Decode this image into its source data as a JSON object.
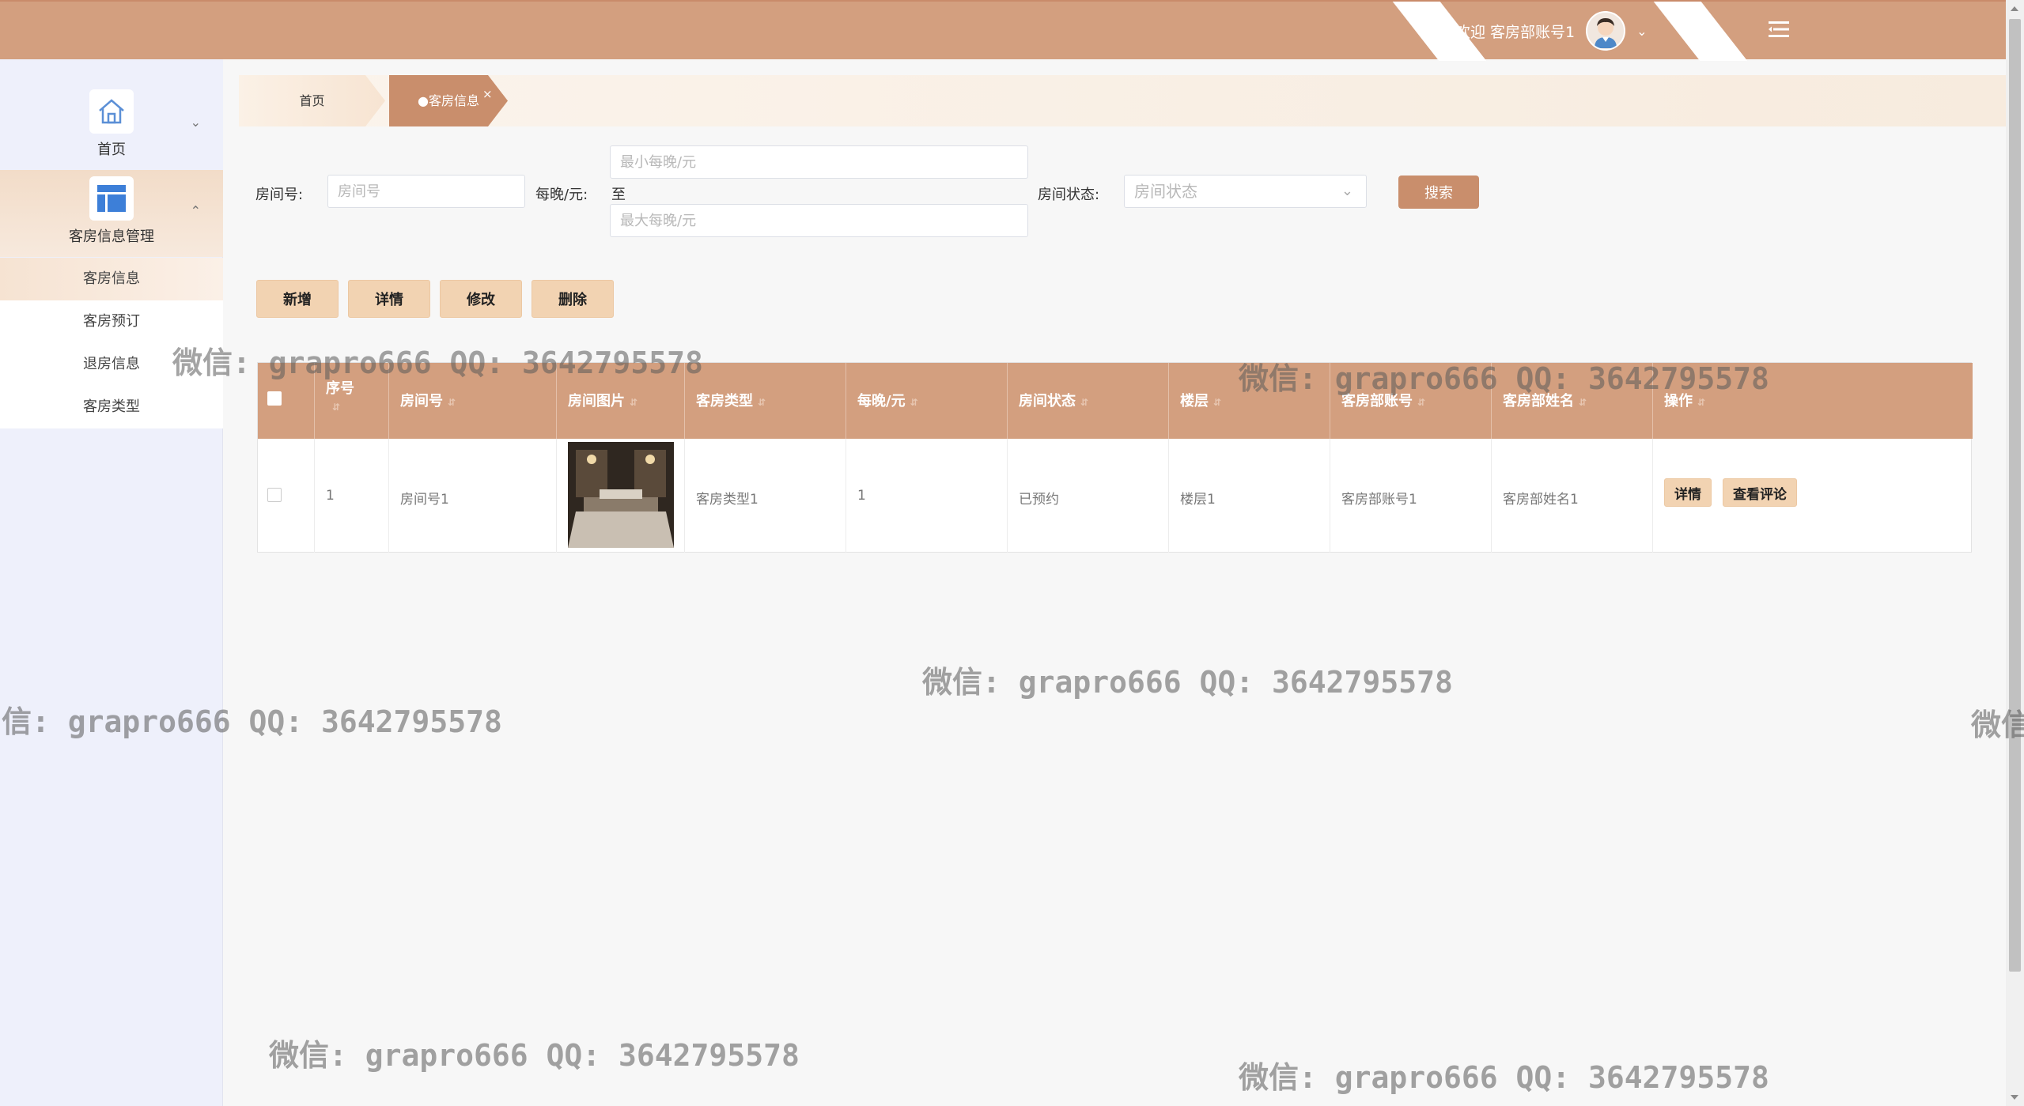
{
  "header": {
    "welcome_text": "欢迎 客房部账号1",
    "colors": {
      "bar": "#d39f7f",
      "accent": "#c98e6c",
      "button_fill": "#f2d3b2"
    },
    "icons": {
      "avatar": "user-avatar",
      "dropdown": "chevron-down-icon",
      "menu": "menu-toggle-icon"
    }
  },
  "sidebar": {
    "home_label": "首页",
    "group_label": "客房信息管理",
    "items": [
      {
        "label": "客房信息"
      },
      {
        "label": "客房预订"
      },
      {
        "label": "退房信息"
      },
      {
        "label": "客房类型"
      }
    ]
  },
  "tabs": {
    "home": "首页",
    "active": "●客房信息",
    "close": "×"
  },
  "search": {
    "room_no_label": "房间号:",
    "room_no_placeholder": "房间号",
    "price_label": "每晚/元:",
    "min_placeholder": "最小每晚/元",
    "to_text": "至",
    "max_placeholder": "最大每晚/元",
    "status_label": "房间状态:",
    "status_placeholder": "房间状态",
    "search_button": "搜索"
  },
  "actions": [
    "新增",
    "详情",
    "修改",
    "删除"
  ],
  "table": {
    "columns": [
      "序号",
      "房间号",
      "房间图片",
      "客房类型",
      "每晚/元",
      "房间状态",
      "楼层",
      "客房部账号",
      "客房部姓名",
      "操作"
    ],
    "rows": [
      {
        "index": "1",
        "room_no": "房间号1",
        "room_type": "客房类型1",
        "price": "1",
        "status": "已预约",
        "floor": "楼层1",
        "account": "客房部账号1",
        "name": "客房部姓名1",
        "ops": [
          "详情",
          "查看评论"
        ]
      }
    ]
  },
  "watermark": "微信: grapro666 QQ: 3642795578",
  "watermark_fragments": {
    "left": "信: grapro666 QQ: 3642795578",
    "right": "微信"
  }
}
